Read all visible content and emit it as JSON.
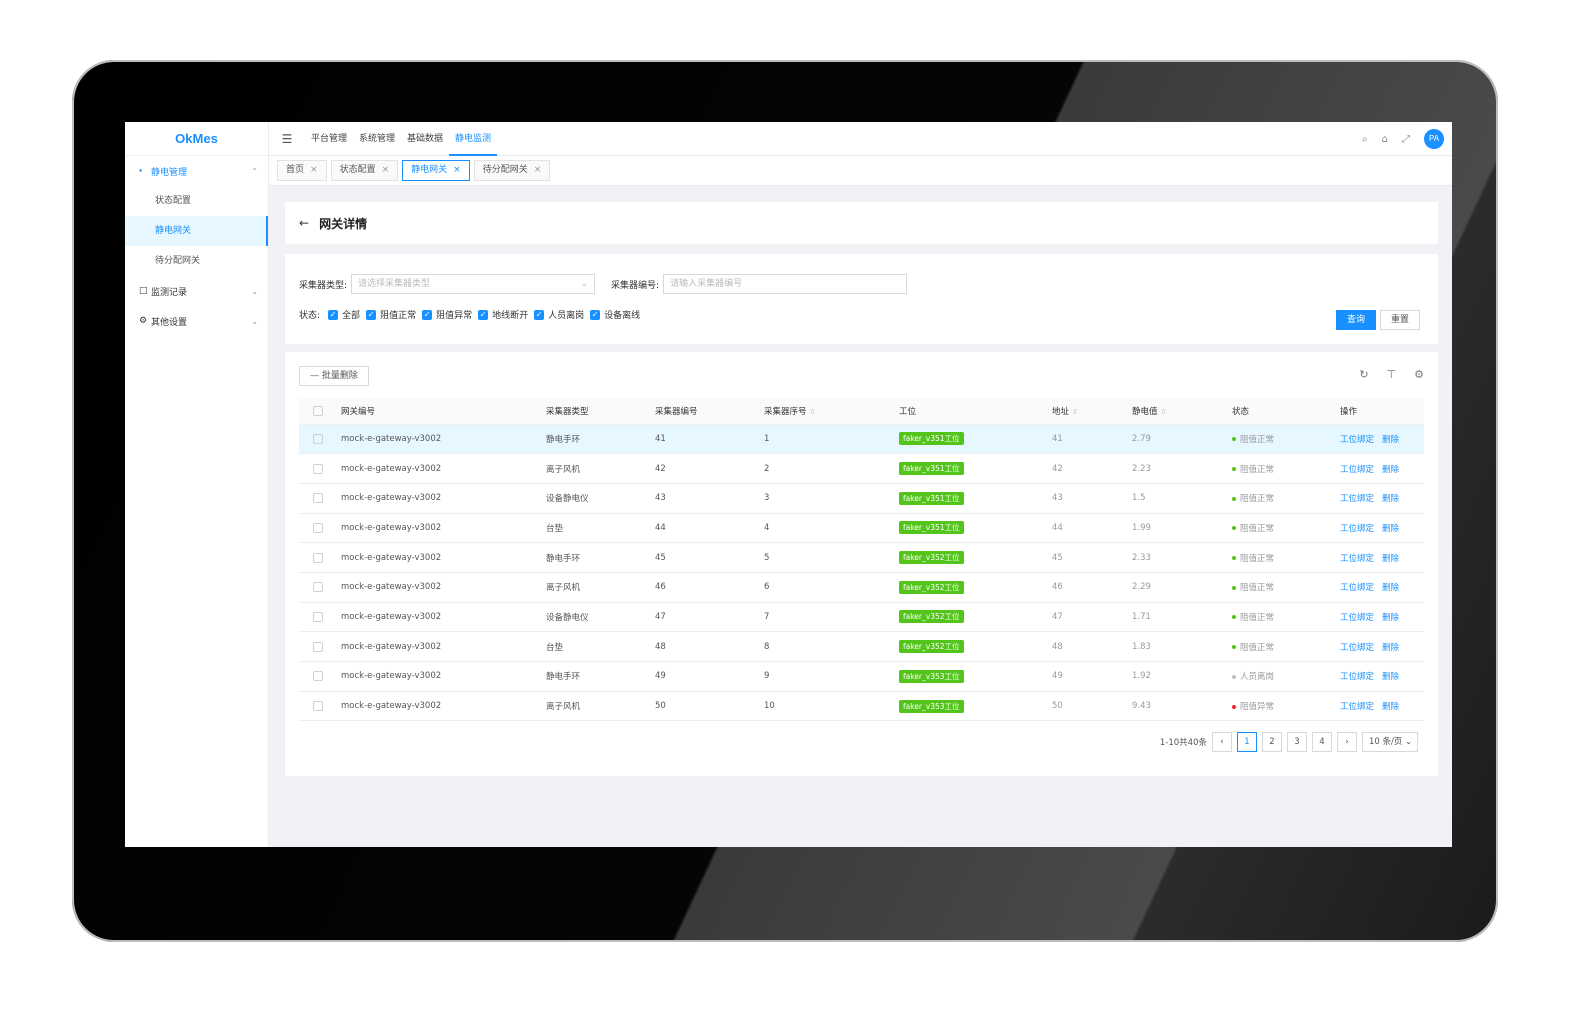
{
  "app": {
    "logo": "OkMes"
  },
  "sidebar": {
    "groups": [
      {
        "label": "静电管理",
        "icon": "share-icon",
        "chevron": "⌃"
      },
      {
        "label": "监测记录",
        "icon": "calendar-icon",
        "chevron": "⌄"
      },
      {
        "label": "其他设置",
        "icon": "gear-icon",
        "chevron": "⌄"
      }
    ],
    "items": [
      {
        "label": "状态配置"
      },
      {
        "label": "静电网关"
      },
      {
        "label": "待分配网关"
      }
    ]
  },
  "header": {
    "nav": [
      {
        "label": "平台管理"
      },
      {
        "label": "系统管理"
      },
      {
        "label": "基础数据"
      },
      {
        "label": "静电监测"
      }
    ],
    "avatar": "PA"
  },
  "tabs": [
    {
      "label": "首页"
    },
    {
      "label": "状态配置"
    },
    {
      "label": "静电网关"
    },
    {
      "label": "待分配网关"
    }
  ],
  "page": {
    "title": "网关详情"
  },
  "filter": {
    "type_label": "采集器类型:",
    "type_placeholder": "请选择采集器类型",
    "code_label": "采集器编号:",
    "code_placeholder": "请输入采集器编号",
    "status_label": "状态:",
    "statuses": [
      "全部",
      "阻值正常",
      "阻值异常",
      "地线断开",
      "人员离岗",
      "设备离线"
    ],
    "query": "查询",
    "reset": "重置"
  },
  "toolbar": {
    "batch_delete": "批量删除"
  },
  "table": {
    "headers": [
      "网关编号",
      "采集器类型",
      "采集器编号",
      "采集器序号",
      "工位",
      "地址",
      "静电值",
      "状态",
      "操作"
    ],
    "action_bind": "工位绑定",
    "action_delete": "删除",
    "rows": [
      {
        "gw": "mock-e-gateway-v3002",
        "type": "静电手环",
        "code": "41",
        "seq": "1",
        "station": "faker_v351工位",
        "addr": "41",
        "value": "2.79",
        "status": "阻值正常",
        "status_color": "#52c41a"
      },
      {
        "gw": "mock-e-gateway-v3002",
        "type": "离子风机",
        "code": "42",
        "seq": "2",
        "station": "faker_v351工位",
        "addr": "42",
        "value": "2.23",
        "status": "阻值正常",
        "status_color": "#52c41a"
      },
      {
        "gw": "mock-e-gateway-v3002",
        "type": "设备静电仪",
        "code": "43",
        "seq": "3",
        "station": "faker_v351工位",
        "addr": "43",
        "value": "1.5",
        "status": "阻值正常",
        "status_color": "#52c41a"
      },
      {
        "gw": "mock-e-gateway-v3002",
        "type": "台垫",
        "code": "44",
        "seq": "4",
        "station": "faker_v351工位",
        "addr": "44",
        "value": "1.99",
        "status": "阻值正常",
        "status_color": "#52c41a"
      },
      {
        "gw": "mock-e-gateway-v3002",
        "type": "静电手环",
        "code": "45",
        "seq": "5",
        "station": "faker_v352工位",
        "addr": "45",
        "value": "2.33",
        "status": "阻值正常",
        "status_color": "#52c41a"
      },
      {
        "gw": "mock-e-gateway-v3002",
        "type": "离子风机",
        "code": "46",
        "seq": "6",
        "station": "faker_v352工位",
        "addr": "46",
        "value": "2.29",
        "status": "阻值正常",
        "status_color": "#52c41a"
      },
      {
        "gw": "mock-e-gateway-v3002",
        "type": "设备静电仪",
        "code": "47",
        "seq": "7",
        "station": "faker_v352工位",
        "addr": "47",
        "value": "1.71",
        "status": "阻值正常",
        "status_color": "#52c41a"
      },
      {
        "gw": "mock-e-gateway-v3002",
        "type": "台垫",
        "code": "48",
        "seq": "8",
        "station": "faker_v352工位",
        "addr": "48",
        "value": "1.83",
        "status": "阻值正常",
        "status_color": "#52c41a"
      },
      {
        "gw": "mock-e-gateway-v3002",
        "type": "静电手环",
        "code": "49",
        "seq": "9",
        "station": "faker_v353工位",
        "addr": "49",
        "value": "1.92",
        "status": "人员离岗",
        "status_color": "#bfbfbf"
      },
      {
        "gw": "mock-e-gateway-v3002",
        "type": "离子风机",
        "code": "50",
        "seq": "10",
        "station": "faker_v353工位",
        "addr": "50",
        "value": "9.43",
        "status": "阻值异常",
        "status_color": "#f5222d"
      }
    ]
  },
  "pagination": {
    "summary": "1-10共40条",
    "pages": [
      "1",
      "2",
      "3",
      "4"
    ],
    "page_size": "10 条/页"
  }
}
